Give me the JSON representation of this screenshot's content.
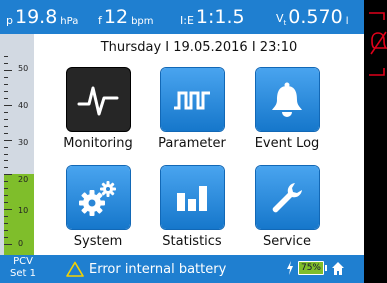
{
  "params": [
    {
      "symbol": "p",
      "value": "19.8",
      "unit": "hPa"
    },
    {
      "symbol": "f",
      "value": "12",
      "unit": "bpm"
    },
    {
      "symbol": "I:E",
      "value": "1:1.5",
      "unit": ""
    },
    {
      "symbol": "V",
      "symbol_sub": "t",
      "value": "0.570",
      "unit": "l"
    }
  ],
  "datetime": "Thursday I 19.05.2016 I 23:10",
  "gauge": {
    "labels": [
      "50",
      "40",
      "30",
      "20",
      "10",
      "0"
    ],
    "fill_value": 20,
    "max": 55
  },
  "tiles": [
    {
      "label": "Monitoring",
      "icon": "monitoring-icon",
      "active": true
    },
    {
      "label": "Parameter",
      "icon": "parameter-icon",
      "active": false
    },
    {
      "label": "Event Log",
      "icon": "bell-icon",
      "active": false
    },
    {
      "label": "System",
      "icon": "gears-icon",
      "active": false
    },
    {
      "label": "Statistics",
      "icon": "bar-chart-icon",
      "active": false
    },
    {
      "label": "Service",
      "icon": "wrench-icon",
      "active": false
    }
  ],
  "status": {
    "mode_line1": "PCV",
    "mode_line2": "Set 1",
    "alarm_text": "Error internal battery",
    "battery": "75%"
  },
  "colors": {
    "accent": "#1f7fd0",
    "gauge_fill": "#7fbe2b",
    "alarm_mute": "#e0001a"
  }
}
